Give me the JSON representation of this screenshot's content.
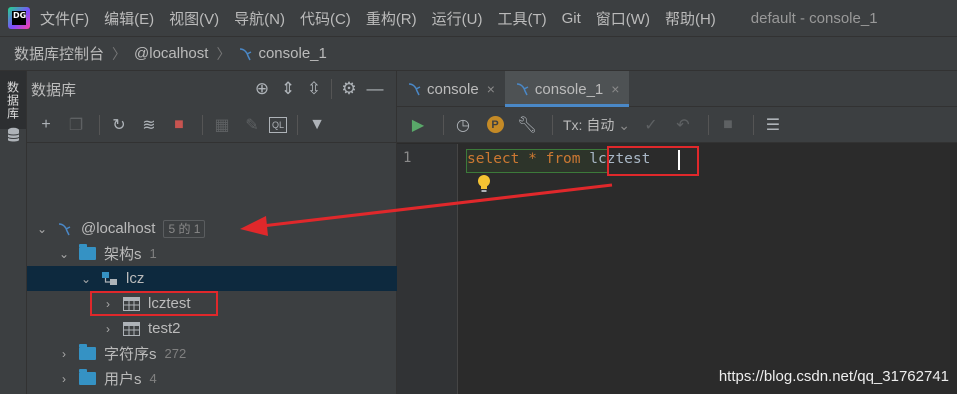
{
  "menubar": {
    "logo_text": "DG",
    "items": [
      "文件(F)",
      "编辑(E)",
      "视图(V)",
      "导航(N)",
      "代码(C)",
      "重构(R)",
      "运行(U)",
      "工具(T)",
      "Git",
      "窗口(W)",
      "帮助(H)"
    ],
    "window_title": "default - console_1"
  },
  "breadcrumb": {
    "items": [
      "数据库控制台",
      "@localhost",
      "console_1"
    ]
  },
  "left_strip": {
    "tab_label": "数据库"
  },
  "db_panel": {
    "title": "数据库",
    "header_icons": [
      "crosshair-icon",
      "expand-all-icon",
      "collapse-all-icon",
      "gear-icon",
      "minimize-icon"
    ],
    "toolbar_icons": [
      "add-icon",
      "copy-icon",
      "refresh-icon",
      "schema-sync-icon",
      "stop-icon",
      "table-editor-icon",
      "edit-icon",
      "ql-console-icon",
      "filter-icon"
    ],
    "tree": [
      {
        "label": "@localhost",
        "badge": "5 的 1",
        "level": 0,
        "expanded": true,
        "icon": "mysql-icon"
      },
      {
        "label": "架构s",
        "count": "1",
        "level": 1,
        "expanded": true,
        "icon": "folder-icon"
      },
      {
        "label": "lcz",
        "level": 2,
        "expanded": true,
        "icon": "schema-icon",
        "selected": true
      },
      {
        "label": "lcztest",
        "level": 3,
        "expanded": false,
        "icon": "table-icon",
        "highlighted": true
      },
      {
        "label": "test2",
        "level": 3,
        "expanded": false,
        "icon": "table-icon"
      },
      {
        "label": "字符序s",
        "count": "272",
        "level": 1,
        "expanded": false,
        "icon": "folder-icon"
      },
      {
        "label": "用户s",
        "count": "4",
        "level": 1,
        "expanded": false,
        "icon": "folder-icon"
      }
    ]
  },
  "editor": {
    "tabs": [
      {
        "label": "console",
        "active": false
      },
      {
        "label": "console_1",
        "active": true
      }
    ],
    "tab_close_glyph": "×",
    "toolbar": {
      "tx_label": "Tx: 自动",
      "icons": [
        "run-icon",
        "history-icon",
        "p-icon",
        "wrench-icon",
        "tx-dropdown-icon",
        "commit-icon",
        "rollback-icon",
        "stop-icon",
        "output-icon"
      ]
    },
    "line_number": "1",
    "code": {
      "kw_select": "select",
      "star": "*",
      "kw_from": "from",
      "ident": "lcztest"
    }
  },
  "watermark": "https://blog.csdn.net/qq_31762741",
  "colors": {
    "accent": "#4a88c7",
    "annotation_red": "#e0282b",
    "keyword": "#cc7832",
    "folder": "#3592c4",
    "selection": "#0d293e"
  }
}
